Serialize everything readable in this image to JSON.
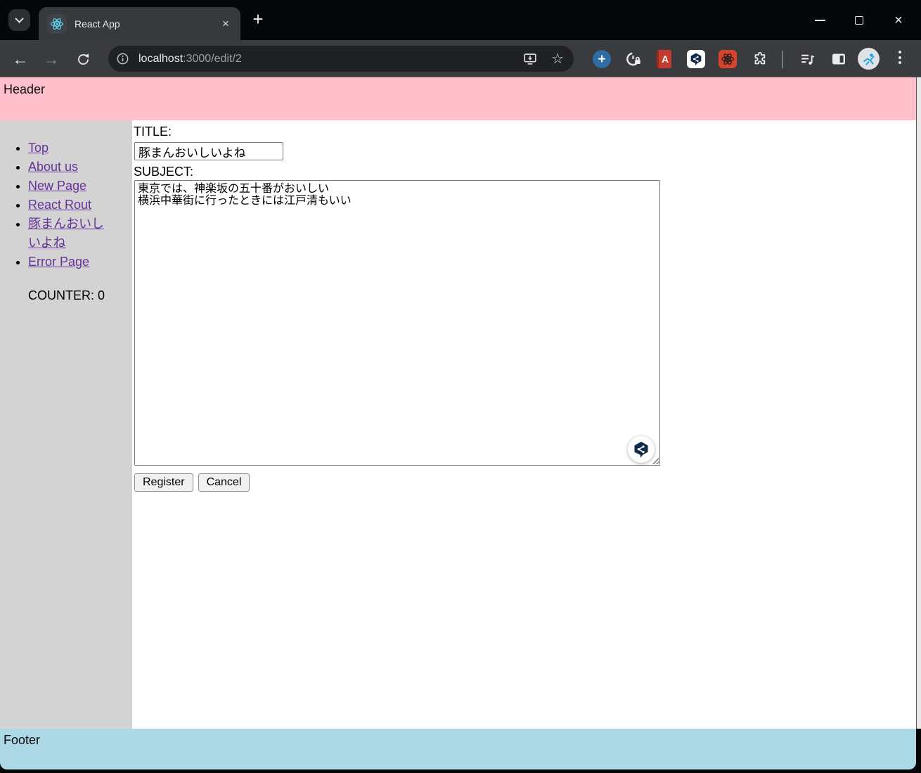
{
  "browser": {
    "tab_title": "React App",
    "url_host": "localhost",
    "url_rest": ":3000/edit/2",
    "glyphs": {
      "back": "←",
      "forward": "→",
      "star": "☆",
      "tab_close": "×",
      "new_tab": "+",
      "close_window": "×",
      "ext_plus": "+",
      "book_letter": "A"
    },
    "colors": {
      "react_logo": "#61DAFB",
      "deepl_navy": "#0F2B46",
      "devtools_red": "#D8432F"
    }
  },
  "page": {
    "header_text": "Header",
    "sidebar": {
      "links": [
        "Top",
        "About us",
        "New Page",
        "React Rout",
        "豚まんおいしいよね",
        "Error Page"
      ],
      "counter": "COUNTER: 0"
    },
    "form": {
      "title_label": "TITLE:",
      "title_value": "豚まんおいしいよね",
      "subject_label": "SUBJECT:",
      "subject_value": "東京では、神楽坂の五十番がおいしい\n横浜中華街に行ったときには江戸清もいい",
      "register": "Register",
      "cancel": "Cancel"
    },
    "footer_text": "Footer",
    "colors": {
      "header_bg": "#FFC0CB",
      "sidebar_bg": "#D3D3D3",
      "footer_bg": "#ADD8E6",
      "link_purple": "#663399"
    }
  }
}
